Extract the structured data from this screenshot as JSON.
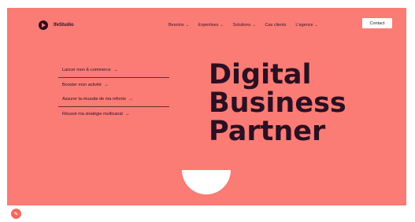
{
  "header": {
    "logo_text": "IfeStudio",
    "nav": [
      {
        "label": "Besoins"
      },
      {
        "label": "Expertises"
      },
      {
        "label": "Solutions"
      },
      {
        "label": "Cas clients"
      },
      {
        "label": "L'agence"
      }
    ],
    "contact_label": "Contact"
  },
  "links": [
    {
      "label": "Lancer mon E-commerce"
    },
    {
      "label": "Booster mon activité"
    },
    {
      "label": "Assurer la réussite de ma refonte"
    },
    {
      "label": "Réussir ma stratégie multicanal"
    }
  ],
  "headline": {
    "line1": "Digital",
    "line2": "Business",
    "line3": "Partner"
  },
  "colors": {
    "hero_bg": "#fa7c74",
    "text_dark": "#2b0f22",
    "white": "#ffffff"
  },
  "icons": {
    "logo": "play-circle-icon",
    "nav_chevron": "chevron-down-icon",
    "link_arrow": "arrow-right-icon",
    "corner": "chat-bubble-icon"
  }
}
